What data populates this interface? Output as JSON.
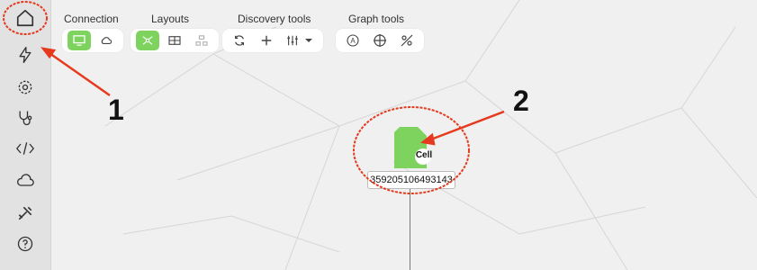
{
  "toolbar": {
    "connection": {
      "label": "Connection"
    },
    "layouts": {
      "label": "Layouts"
    },
    "discovery": {
      "label": "Discovery tools"
    },
    "graph": {
      "label": "Graph tools"
    }
  },
  "node": {
    "badge": "Cell",
    "label": "359205106493143",
    "color": "#7ed35f"
  },
  "annotations": {
    "one": "1",
    "two": "2",
    "color": "#e53a1e"
  },
  "sidebar": {
    "items": [
      "home-icon",
      "lightning-icon",
      "gear-icon",
      "stethoscope-icon",
      "code-icon",
      "cloud-icon",
      "tools-icon",
      "help-icon"
    ]
  }
}
